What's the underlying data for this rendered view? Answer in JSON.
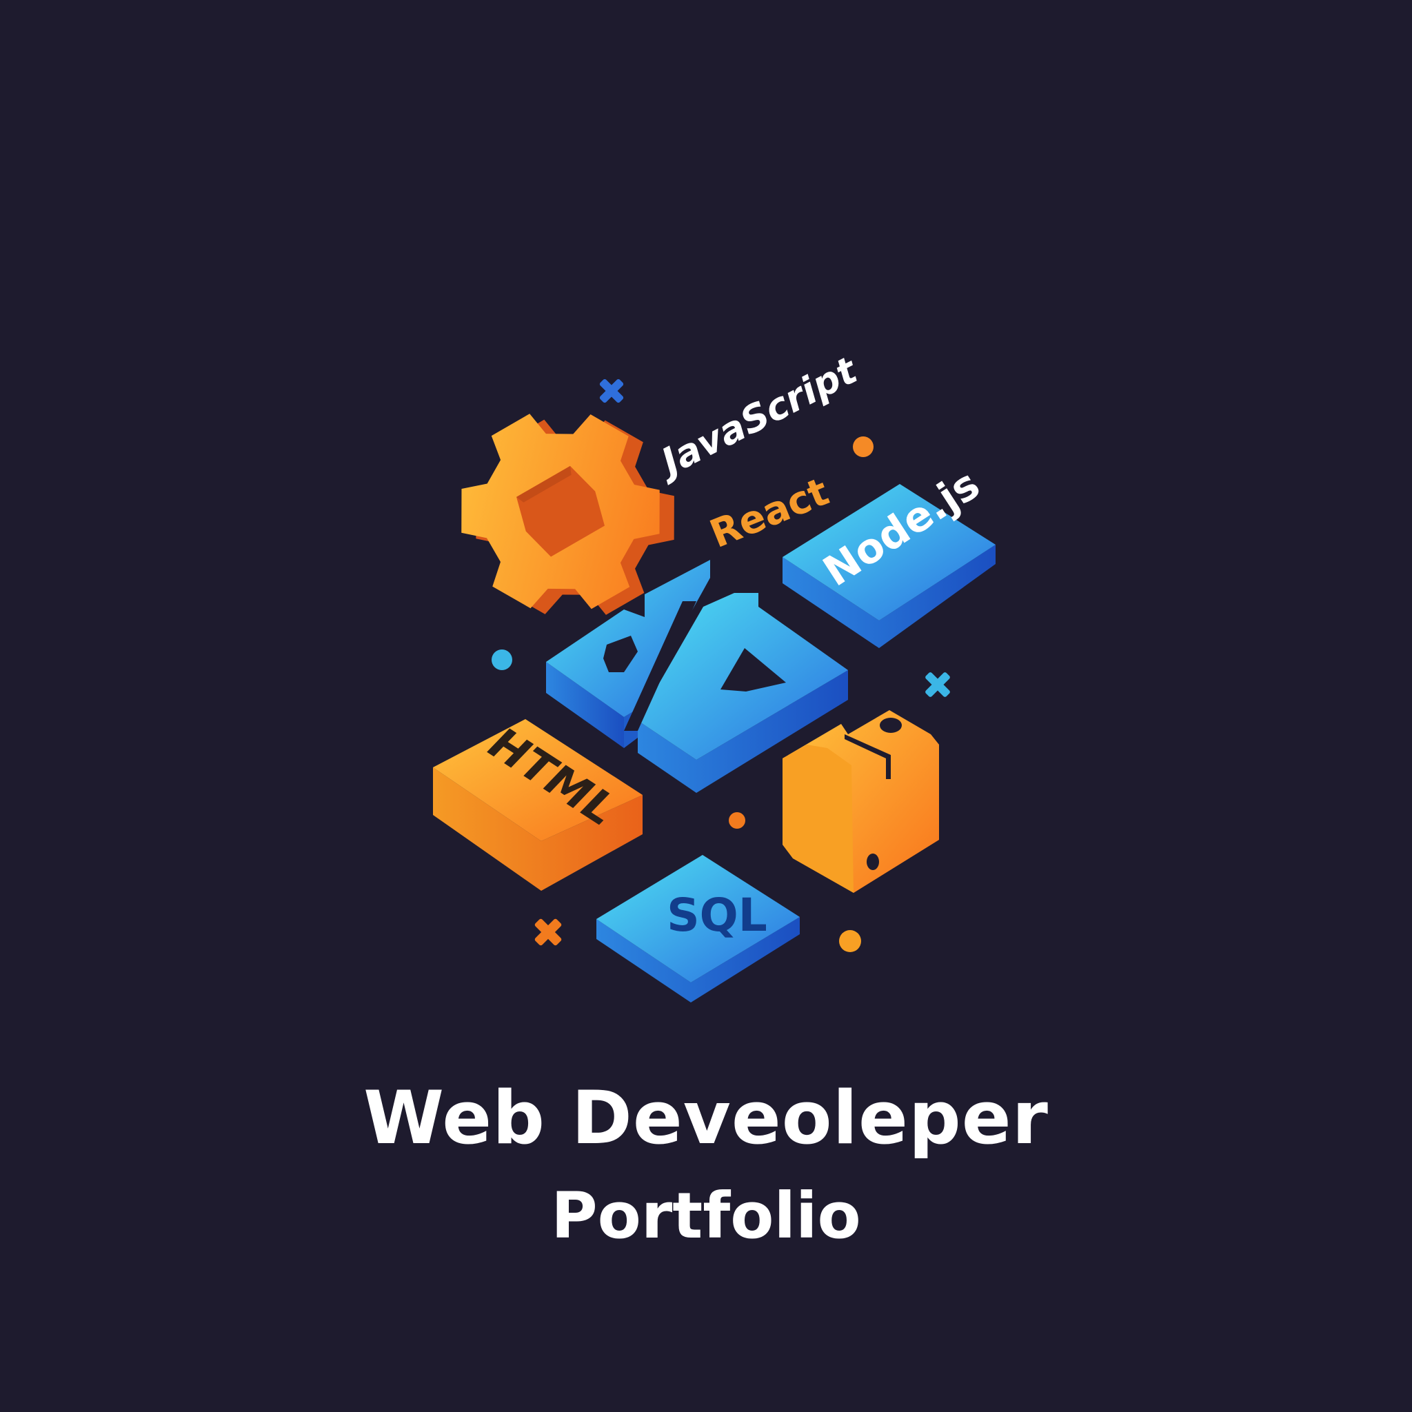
{
  "heading": {
    "title": "Web Deveoleper",
    "subtitle": "Portfolio"
  },
  "labels": {
    "javascript": "JavaScript",
    "react": "React",
    "node": "Node.js",
    "html": "HTML",
    "sql": "SQL"
  },
  "colors": {
    "background": "#1e1b2e",
    "orange": "#fb8c1f",
    "blue": "#2f8ae8",
    "cyan": "#45c8ec",
    "white": "#ffffff"
  },
  "icons": [
    "gear-icon",
    "code-brackets-icon",
    "python-logo-icon",
    "sparkle-cross-icon",
    "dot-icon"
  ]
}
